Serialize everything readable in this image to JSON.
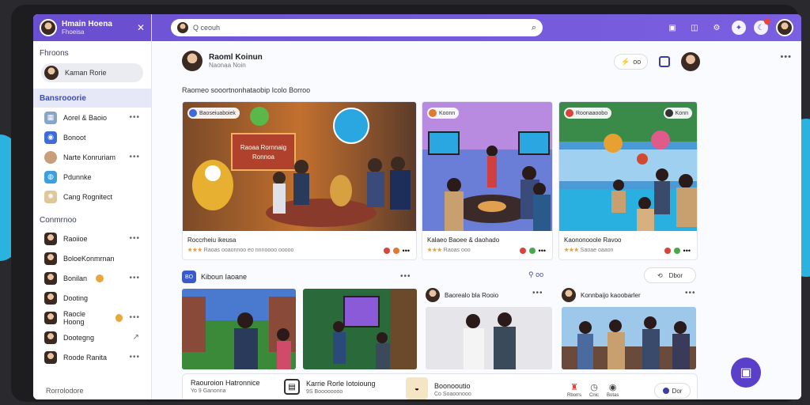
{
  "sidebar": {
    "user_name": "Hmain Hoena",
    "user_sub": "Fhoeisa",
    "section_friends": "Fhroons",
    "profile_name": "Kaman Rorie",
    "section_groups": "Bansrooorie",
    "groups": [
      {
        "label": "Aorel & Baoio",
        "icon": "group-icon",
        "color": "#8aa3c9",
        "dots": "•••"
      },
      {
        "label": "Bonoot",
        "icon": "people-icon",
        "color": "#3e6bd8",
        "dots": ""
      },
      {
        "label": "Narte Konruriam",
        "icon": "avatar",
        "color": "#c89f7a",
        "dots": "•••"
      },
      {
        "label": "Pdunnke",
        "icon": "globe-icon",
        "color": "#3aa0e0",
        "dots": ""
      },
      {
        "label": "Cang Rognitect",
        "icon": "lightbulb-icon",
        "color": "#e0c79a",
        "dots": ""
      }
    ],
    "section_contacts": "Conmrnoo",
    "contacts": [
      {
        "label": "Raoiioe",
        "dots": "•••",
        "badge": false
      },
      {
        "label": "BoloeKonmrnan",
        "dots": "",
        "badge": false
      },
      {
        "label": "Bonilan",
        "dots": "•••",
        "badge": true
      },
      {
        "label": "Dooting",
        "dots": "",
        "badge": false
      },
      {
        "label": "Raocle Hoong",
        "dots": "•••",
        "badge": true
      },
      {
        "label": "Dootegng",
        "dots": "↗",
        "badge": false
      },
      {
        "label": "Roode Ranita",
        "dots": "•••",
        "badge": false
      }
    ],
    "footer": "Rorrolodore"
  },
  "topbar": {
    "search_placeholder": "Q ceouh",
    "icons": [
      "chat-icon",
      "grid-icon",
      "settings-icon",
      "bell-icon",
      "moon-icon",
      "avatar"
    ]
  },
  "post": {
    "author": "Raoml Koinun",
    "time": "Naonaa Noin",
    "action_label": "oo",
    "caption": "Raomeo sooortnonhataobip Icolo Borroo",
    "more": "•••"
  },
  "cards": [
    {
      "tag": "Baoseiuaboiek",
      "photo_title": "Raoaa Rornnaig\nRonnoa",
      "caption": "Roccrheiu ikeusa",
      "stars": "★★★",
      "meta": "Raoas ooaonnoo eo nnnoooo ooooo",
      "dots": "•••"
    },
    {
      "tag": "Koonn",
      "caption": "Kalaeo Baoee & daohado",
      "stars": "★★★",
      "meta": "Raoas ooo",
      "dots": "•••"
    },
    {
      "tag": "Roonaaoobo",
      "tag2": "Konn",
      "caption": "Kaononooole Ravoo",
      "stars": "★★★",
      "meta": "Saoae oaaon",
      "dots": "•••"
    }
  ],
  "section2": {
    "badge": "BO",
    "title": "Kiboun Iaoane",
    "more": "•••",
    "link": "oo",
    "btn": "Dbor"
  },
  "mini_cards": [
    {
      "name": "Baorealo bla Rooio",
      "more": "•••"
    },
    {
      "name": "Konnbaijo kaoobarler",
      "more": "•••"
    }
  ],
  "bottom_bar": {
    "items": [
      {
        "title": "Raouroion Hatronnice",
        "sub": "Yo 9 Ganonna"
      },
      {
        "title": "Karrie Rorle Iotoioung",
        "sub": "9S Boooooooo"
      },
      {
        "title": "Boonooutio",
        "sub": "Co Soaoonooo"
      }
    ],
    "stats": [
      "Rborrs",
      "Cnic",
      "Botas"
    ],
    "btn": "Dor"
  },
  "colors": {
    "accent": "#6f55d6",
    "brand": "#3b59c9"
  }
}
